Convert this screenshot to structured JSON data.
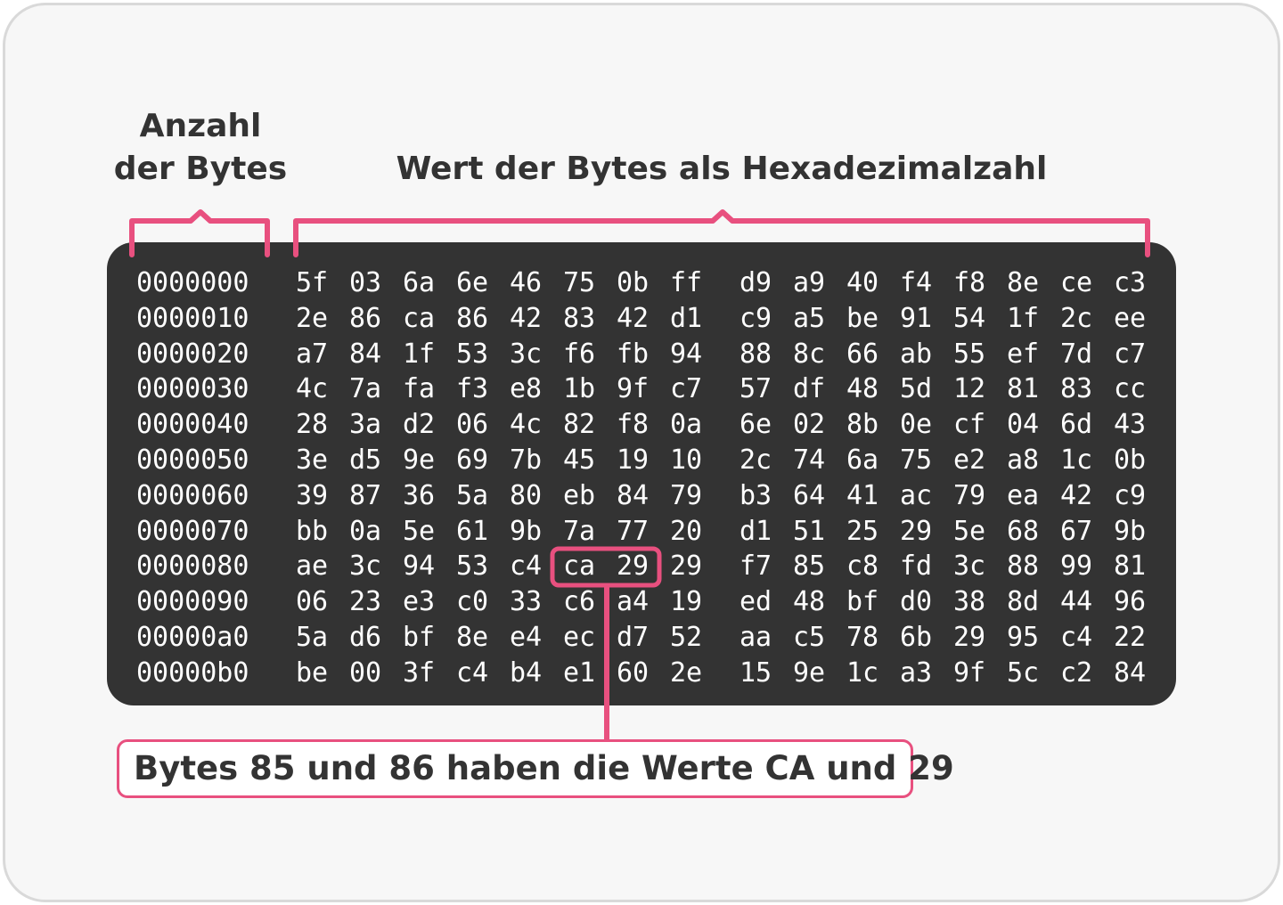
{
  "labels": {
    "bytes_count_line1": "Anzahl",
    "bytes_count_line2": "der Bytes",
    "hex_values": "Wert der Bytes als Hexadezimalzahl"
  },
  "callout": {
    "text": "Bytes 85 und 86 haben die Werte CA und 29"
  },
  "highlight": {
    "row": 8,
    "first_byte_column": 5,
    "byte_count": 2
  },
  "colors": {
    "accent": "#e8507f",
    "panel": "#333333",
    "text": "#333333",
    "background": "#f7f7f7"
  },
  "hex_dump": [
    {
      "offset": "0000000",
      "bytes": [
        "5f",
        "03",
        "6a",
        "6e",
        "46",
        "75",
        "0b",
        "ff",
        "d9",
        "a9",
        "40",
        "f4",
        "f8",
        "8e",
        "ce",
        "c3"
      ]
    },
    {
      "offset": "0000010",
      "bytes": [
        "2e",
        "86",
        "ca",
        "86",
        "42",
        "83",
        "42",
        "d1",
        "c9",
        "a5",
        "be",
        "91",
        "54",
        "1f",
        "2c",
        "ee"
      ]
    },
    {
      "offset": "0000020",
      "bytes": [
        "a7",
        "84",
        "1f",
        "53",
        "3c",
        "f6",
        "fb",
        "94",
        "88",
        "8c",
        "66",
        "ab",
        "55",
        "ef",
        "7d",
        "c7"
      ]
    },
    {
      "offset": "0000030",
      "bytes": [
        "4c",
        "7a",
        "fa",
        "f3",
        "e8",
        "1b",
        "9f",
        "c7",
        "57",
        "df",
        "48",
        "5d",
        "12",
        "81",
        "83",
        "cc"
      ]
    },
    {
      "offset": "0000040",
      "bytes": [
        "28",
        "3a",
        "d2",
        "06",
        "4c",
        "82",
        "f8",
        "0a",
        "6e",
        "02",
        "8b",
        "0e",
        "cf",
        "04",
        "6d",
        "43"
      ]
    },
    {
      "offset": "0000050",
      "bytes": [
        "3e",
        "d5",
        "9e",
        "69",
        "7b",
        "45",
        "19",
        "10",
        "2c",
        "74",
        "6a",
        "75",
        "e2",
        "a8",
        "1c",
        "0b"
      ]
    },
    {
      "offset": "0000060",
      "bytes": [
        "39",
        "87",
        "36",
        "5a",
        "80",
        "eb",
        "84",
        "79",
        "b3",
        "64",
        "41",
        "ac",
        "79",
        "ea",
        "42",
        "c9"
      ]
    },
    {
      "offset": "0000070",
      "bytes": [
        "bb",
        "0a",
        "5e",
        "61",
        "9b",
        "7a",
        "77",
        "20",
        "d1",
        "51",
        "25",
        "29",
        "5e",
        "68",
        "67",
        "9b"
      ]
    },
    {
      "offset": "0000080",
      "bytes": [
        "ae",
        "3c",
        "94",
        "53",
        "c4",
        "ca",
        "29",
        "29",
        "f7",
        "85",
        "c8",
        "fd",
        "3c",
        "88",
        "99",
        "81"
      ]
    },
    {
      "offset": "0000090",
      "bytes": [
        "06",
        "23",
        "e3",
        "c0",
        "33",
        "c6",
        "a4",
        "19",
        "ed",
        "48",
        "bf",
        "d0",
        "38",
        "8d",
        "44",
        "96"
      ]
    },
    {
      "offset": "00000a0",
      "bytes": [
        "5a",
        "d6",
        "bf",
        "8e",
        "e4",
        "ec",
        "d7",
        "52",
        "aa",
        "c5",
        "78",
        "6b",
        "29",
        "95",
        "c4",
        "22"
      ]
    },
    {
      "offset": "00000b0",
      "bytes": [
        "be",
        "00",
        "3f",
        "c4",
        "b4",
        "e1",
        "60",
        "2e",
        "15",
        "9e",
        "1c",
        "a3",
        "9f",
        "5c",
        "c2",
        "84"
      ]
    }
  ]
}
